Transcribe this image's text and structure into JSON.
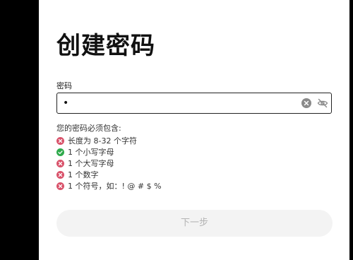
{
  "page": {
    "title": "创建密码"
  },
  "password_field": {
    "label": "密码",
    "value": "•",
    "clear_icon": "clear-circle-icon",
    "visibility_icon": "eye-off-icon"
  },
  "requirements": {
    "heading": "您的密码必须包含:",
    "items": [
      {
        "text": "长度为 8-32 个字符",
        "status": "unmet",
        "icon": "error-circle-icon"
      },
      {
        "text": "1 个小写字母",
        "status": "met",
        "icon": "check-circle-icon"
      },
      {
        "text": "1 个大写字母",
        "status": "unmet",
        "icon": "error-circle-icon"
      },
      {
        "text": "1 个数字",
        "status": "unmet",
        "icon": "error-circle-icon"
      },
      {
        "text": "1 个符号，如：! @ # $ %",
        "status": "unmet",
        "icon": "error-circle-icon"
      }
    ]
  },
  "actions": {
    "next_label": "下一步"
  },
  "colors": {
    "unmet": "#d9536b",
    "met": "#2faa4c",
    "disabled_button_bg": "#f3f3f3",
    "disabled_button_text": "#b3b3b3"
  }
}
